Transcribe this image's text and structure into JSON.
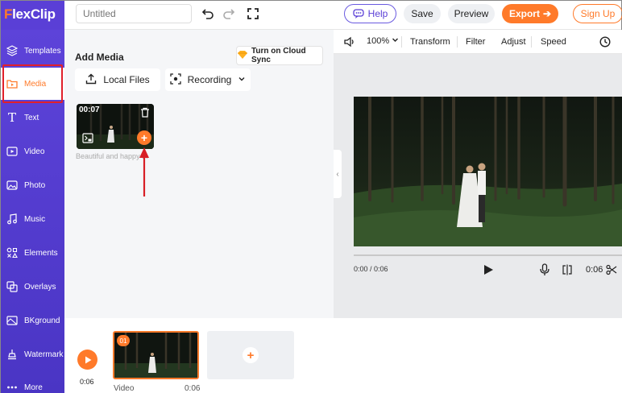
{
  "app": {
    "logo_first_letter": "F",
    "logo_rest": "lexClip"
  },
  "header": {
    "title_placeholder": "Untitled",
    "help_label": "Help",
    "save_label": "Save",
    "preview_label": "Preview",
    "export_label": "Export",
    "signup_label": "Sign Up"
  },
  "sidebar": {
    "items": [
      {
        "label": "Templates",
        "icon": "layers-icon"
      },
      {
        "label": "Media",
        "icon": "media-folder-icon",
        "active": true
      },
      {
        "label": "Text",
        "icon": "text-icon"
      },
      {
        "label": "Video",
        "icon": "video-icon"
      },
      {
        "label": "Photo",
        "icon": "photo-icon"
      },
      {
        "label": "Music",
        "icon": "music-icon"
      },
      {
        "label": "Elements",
        "icon": "elements-icon"
      },
      {
        "label": "Overlays",
        "icon": "overlays-icon"
      },
      {
        "label": "BKground",
        "icon": "background-icon"
      },
      {
        "label": "Watermark",
        "icon": "watermark-icon"
      },
      {
        "label": "More",
        "icon": "more-icon"
      }
    ]
  },
  "media_panel": {
    "title": "Add Media",
    "cloud_sync_label": "Turn on Cloud Sync",
    "local_files_label": "Local Files",
    "recording_label": "Recording",
    "item": {
      "duration": "00:07",
      "caption": "Beautiful and happy ..."
    }
  },
  "preview_toolbar": {
    "zoom": "100%",
    "transform_label": "Transform",
    "filter_label": "Filter",
    "adjust_label": "Adjust",
    "speed_label": "Speed"
  },
  "player": {
    "current_time": "0:00 / 0:06",
    "duration": "0:06"
  },
  "timeline": {
    "total_time": "0:06",
    "clip_number": "01",
    "clip_label": "Video",
    "clip_duration": "0:06"
  },
  "colors": {
    "accent": "#ff7a2a",
    "sidebar": "#5a3fd6",
    "highlight": "#e0202a"
  }
}
